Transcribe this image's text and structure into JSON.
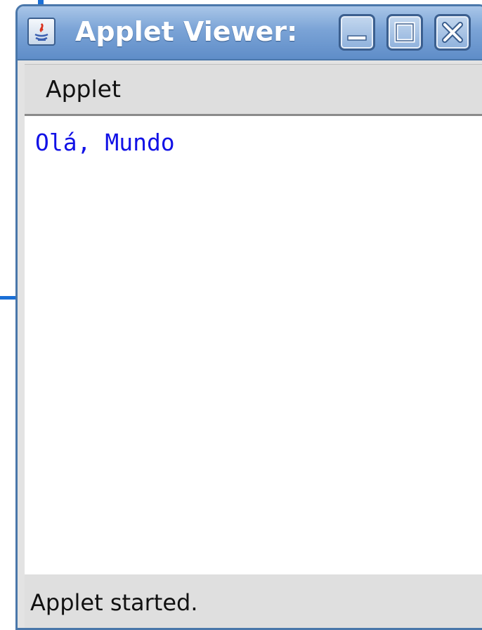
{
  "window": {
    "title": "Applet Viewer:"
  },
  "icons": {
    "app": "java-icon",
    "minimize": "minimize-icon",
    "maximize": "maximize-icon",
    "close": "close-icon"
  },
  "menubar": {
    "items": [
      {
        "label": "Applet"
      }
    ]
  },
  "content": {
    "text": "Olá, Mundo"
  },
  "status": {
    "text": "Applet started."
  },
  "colors": {
    "titlebar": "#7aa3d6",
    "text_blue": "#1212e6",
    "frame": "#4a77aa"
  }
}
